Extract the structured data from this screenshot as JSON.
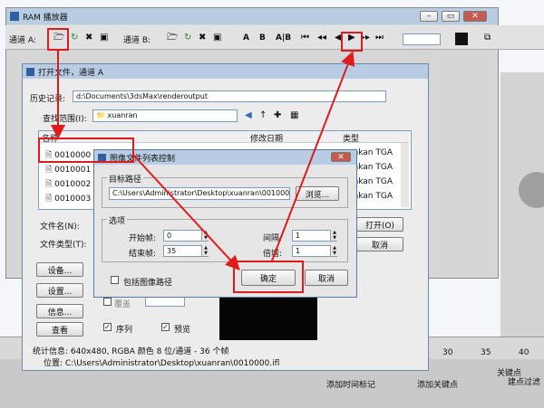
{
  "ram_player": {
    "title": "RAM 播放器",
    "channel_a": "通道 A:",
    "channel_b": "通道 B:",
    "letters": [
      "A",
      "B",
      "A|B"
    ]
  },
  "open_file": {
    "title": "打开文件，通道 A",
    "history_label": "历史记录:",
    "history_value": "d:\\Documents\\3dsMax\\renderoutput",
    "lookin_label": "查找范围(I):",
    "lookin_value": "xuanran",
    "columns": [
      "名称",
      "修改日期",
      "类型"
    ],
    "files": [
      "0010000",
      "0010001",
      "0010002",
      "0010003"
    ],
    "file_type": "ankan TGA",
    "filename_label": "文件名(N):",
    "filetype_label": "文件类型(T):",
    "open_button": "打开(O)",
    "cancel_button": "取消",
    "setup_button": "设备...",
    "settings_button": "设置...",
    "info_button": "信息...",
    "view_button": "查看",
    "gamma_label": "覆盖",
    "sequence_label": "序列",
    "preview_label": "预览",
    "stats": "统计信息: 640x480, RGBA 颜色 8 位/通道 - 36 个帧",
    "location": "位置: C:\\Users\\Administrator\\Desktop\\xuanran\\0010000.ifl"
  },
  "ifl_dialog": {
    "title": "图像文件列表控制",
    "target_group": "目标路径",
    "target_path": "C:\\Users\\Administrator\\Desktop\\xuanran\\0010000.ifl",
    "browse_button": "浏览...",
    "options_group": "选项",
    "start_label": "开始帧:",
    "start_value": "0",
    "end_label": "结束帧:",
    "end_value": "35",
    "every_label": "间隔:",
    "every_value": "1",
    "multiplier_label": "倍增:",
    "multiplier_value": "1",
    "include_path_label": "包括图像路径",
    "ok_button": "确定",
    "cancel_button": "取消"
  },
  "background": {
    "timeline_ticks": [
      "30",
      "35",
      "40"
    ],
    "text_a": "关键点",
    "text_b": "添加时间标记",
    "text_c": "添加关键点",
    "text_d": "建点过滤"
  },
  "colors": {
    "annotation": "#e01b1b",
    "title_bar": "#b8cde3",
    "dialog_bg": "#ececec"
  }
}
